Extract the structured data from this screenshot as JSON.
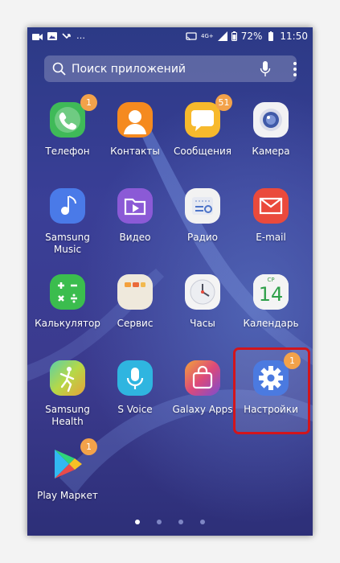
{
  "status_bar": {
    "network": "4G+",
    "battery": "72%",
    "time": "11:50"
  },
  "search": {
    "placeholder": "Поиск приложений"
  },
  "apps": [
    {
      "label": "Телефон",
      "badge": "1",
      "icon": "phone-icon",
      "color": "#3fba58"
    },
    {
      "label": "Контакты",
      "badge": "",
      "icon": "contacts-icon",
      "color": "#f58a1f"
    },
    {
      "label": "Сообщения",
      "badge": "51",
      "icon": "messages-icon",
      "color": "#f7b92c"
    },
    {
      "label": "Камера",
      "badge": "",
      "icon": "camera-icon",
      "color": "#f2f2f4"
    },
    {
      "label": "Samsung Music",
      "badge": "",
      "icon": "music-icon",
      "color": "#4a7ae8"
    },
    {
      "label": "Видео",
      "badge": "",
      "icon": "video-icon",
      "color": "#8b5ad6"
    },
    {
      "label": "Радио",
      "badge": "",
      "icon": "radio-icon",
      "color": "#f2f2f2"
    },
    {
      "label": "E-mail",
      "badge": "",
      "icon": "email-icon",
      "color": "#ea4a3c"
    },
    {
      "label": "Калькулятор",
      "badge": "",
      "icon": "calculator-icon",
      "color": "#3bbd4e"
    },
    {
      "label": "Сервис",
      "badge": "",
      "icon": "service-folder-icon",
      "color": "#efe9dc"
    },
    {
      "label": "Часы",
      "badge": "",
      "icon": "clock-icon",
      "color": "#f4f4f4"
    },
    {
      "label": "Календарь",
      "badge": "",
      "icon": "calendar-icon",
      "color": "#f4f4f4",
      "month": "СР",
      "day": "14"
    },
    {
      "label": "Samsung Health",
      "badge": "",
      "icon": "health-icon",
      "color": "#4cc4c6"
    },
    {
      "label": "S Voice",
      "badge": "",
      "icon": "voice-icon",
      "color": "#2fb5e0"
    },
    {
      "label": "Galaxy Apps",
      "badge": "",
      "icon": "galaxy-apps-icon",
      "color": "#d44f7e"
    },
    {
      "label": "Настройки",
      "badge": "1",
      "icon": "settings-gear-icon",
      "color": "#4b7ae0"
    },
    {
      "label": "Play Маркет",
      "badge": "1",
      "icon": "play-store-icon",
      "color": "#ffffff"
    }
  ],
  "pager": {
    "pages": 4,
    "active": 0
  },
  "colors": {
    "badge": "#f3a24a",
    "highlight": "#d2151c"
  }
}
